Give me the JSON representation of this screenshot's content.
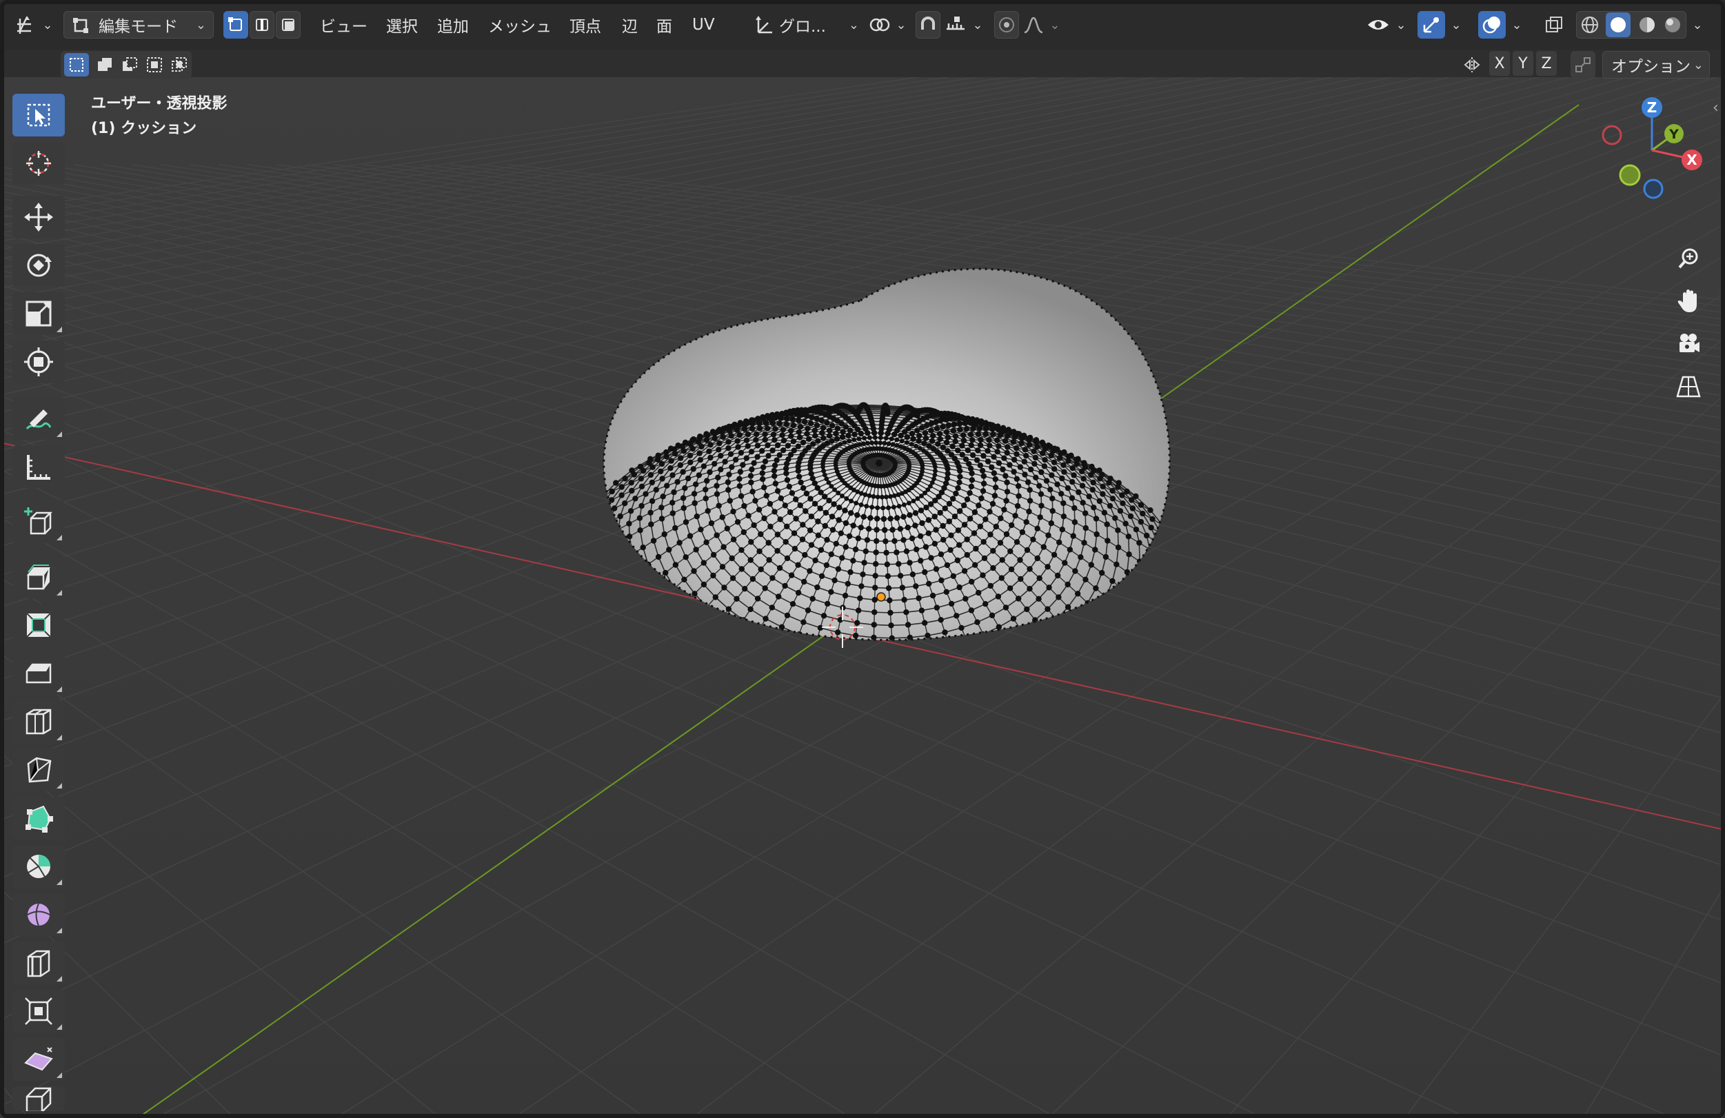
{
  "header": {
    "editor_type_icon": "editor-type-icon",
    "mode_label": "編集モード",
    "menus": [
      "ビュー",
      "選択",
      "追加",
      "メッシュ",
      "頂点",
      "辺",
      "面",
      "UV"
    ],
    "transform_orientation": "グロ...",
    "options_label": "オプション",
    "axes": [
      "X",
      "Y",
      "Z"
    ]
  },
  "viewport": {
    "view_label": "ユーザー・透視投影",
    "object_label": "(1) クッション"
  },
  "gizmo": {
    "z": "Z",
    "y": "Y",
    "x": "X"
  },
  "colors": {
    "accent_blue": "#4772b3",
    "axis_x": "#e34a55",
    "axis_y": "#8ab233",
    "axis_z": "#3d82d9",
    "grid_x_line": "#b03a44",
    "grid_y_line": "#6f9a22",
    "mesh_surface": "#c9c9c9",
    "vertex": "#111111",
    "origin": "#ff9e1a"
  },
  "toolbar_tools": [
    {
      "name": "select-box-tool",
      "icon": "select-box-icon"
    },
    {
      "name": "cursor-tool",
      "icon": "cursor-icon"
    },
    {
      "name": "move-tool",
      "icon": "move-icon"
    },
    {
      "name": "rotate-tool",
      "icon": "rotate-icon"
    },
    {
      "name": "scale-tool",
      "icon": "scale-icon"
    },
    {
      "name": "transform-tool",
      "icon": "transform-icon"
    },
    {
      "name": "annotate-tool",
      "icon": "annotate-icon"
    },
    {
      "name": "measure-tool",
      "icon": "measure-icon"
    },
    {
      "name": "add-cube-tool",
      "icon": "add-cube-icon"
    },
    {
      "name": "extrude-tool",
      "icon": "extrude-icon"
    },
    {
      "name": "inset-tool",
      "icon": "inset-icon"
    },
    {
      "name": "bevel-tool",
      "icon": "bevel-icon"
    },
    {
      "name": "loop-cut-tool",
      "icon": "loop-cut-icon"
    },
    {
      "name": "knife-tool",
      "icon": "knife-icon"
    },
    {
      "name": "poly-build-tool",
      "icon": "poly-build-icon"
    },
    {
      "name": "spin-tool",
      "icon": "spin-icon"
    },
    {
      "name": "smooth-tool",
      "icon": "smooth-icon"
    },
    {
      "name": "edge-slide-tool",
      "icon": "edge-slide-icon"
    },
    {
      "name": "shrink-fatten-tool",
      "icon": "shrink-fatten-icon"
    },
    {
      "name": "shear-tool",
      "icon": "shear-icon"
    },
    {
      "name": "rip-tool",
      "icon": "rip-icon"
    }
  ]
}
